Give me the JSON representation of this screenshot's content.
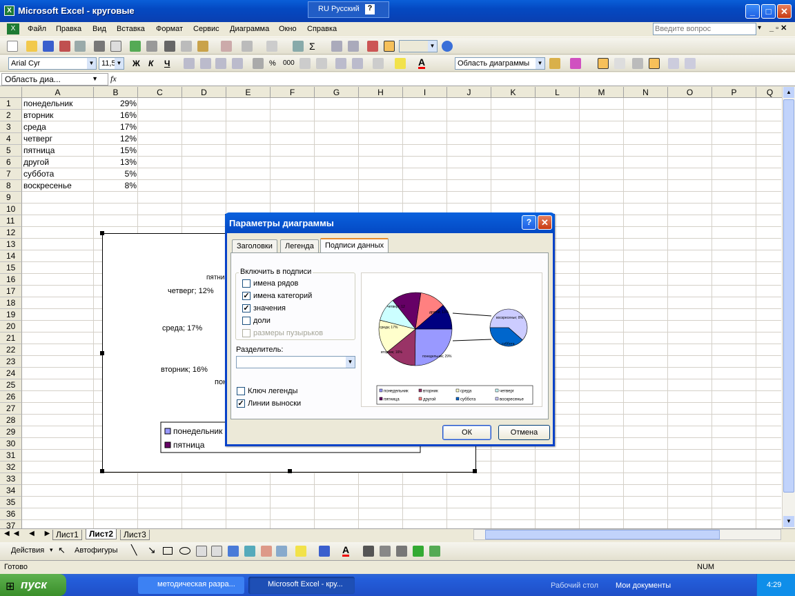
{
  "window": {
    "title": "Microsoft Excel - круговые"
  },
  "langbar": {
    "label": "RU Русский"
  },
  "menu": {
    "items": [
      "Файл",
      "Правка",
      "Вид",
      "Вставка",
      "Формат",
      "Сервис",
      "Диаграмма",
      "Окно",
      "Справка"
    ],
    "ask_placeholder": "Введите вопрос"
  },
  "formatting": {
    "font": "Arial Cyr",
    "size": "11,5",
    "bold": "Ж",
    "italic": "К",
    "underline": "Ч",
    "chart_object": "Область диаграммы"
  },
  "formula_bar": {
    "name_box": "Область диа...",
    "fx": "fx"
  },
  "columns": [
    "A",
    "B",
    "C",
    "D",
    "E",
    "F",
    "G",
    "H",
    "I",
    "J",
    "K",
    "L",
    "M",
    "N",
    "O",
    "P",
    "Q"
  ],
  "rows": [
    "1",
    "2",
    "3",
    "4",
    "5",
    "6",
    "7",
    "8",
    "9",
    "10",
    "11",
    "12",
    "13",
    "14",
    "15",
    "16",
    "17",
    "18",
    "19",
    "20",
    "21",
    "22",
    "23",
    "24",
    "25",
    "26",
    "27",
    "28",
    "29",
    "30",
    "31",
    "32",
    "33",
    "34",
    "35",
    "36",
    "37"
  ],
  "sheet_data": [
    {
      "day": "понедельник",
      "pct": "29%"
    },
    {
      "day": "вторник",
      "pct": "16%"
    },
    {
      "day": "среда",
      "pct": "17%"
    },
    {
      "day": "четверг",
      "pct": "12%"
    },
    {
      "day": "пятница",
      "pct": "15%"
    },
    {
      "day": "другой",
      "pct": "13%"
    },
    {
      "day": "суббота",
      "pct": "5%"
    },
    {
      "day": "воскресенье",
      "pct": "8%"
    }
  ],
  "chart_behind": {
    "labels": [
      "четверг; 12%",
      "среда; 17%",
      "вторник; 16%",
      "пятни",
      "поне"
    ],
    "legend": [
      "понедельник",
      "пятница"
    ]
  },
  "sheet_tabs": [
    "Лист1",
    "Лист2",
    "Лист3"
  ],
  "drawing": {
    "actions": "Действия",
    "autoshapes": "Автофигуры"
  },
  "status": {
    "ready": "Готово",
    "num": "NUM"
  },
  "taskbar": {
    "start": "пуск",
    "tasks": [
      "методическая разра...",
      "Microsoft Excel - кру..."
    ],
    "desktop": "Рабочий стол",
    "docs": "Мои документы",
    "time": "4:29"
  },
  "dialog": {
    "title": "Параметры диаграммы",
    "tabs": [
      "Заголовки",
      "Легенда",
      "Подписи данных"
    ],
    "group_title": "Включить в подписи",
    "options": [
      {
        "label": "имена рядов",
        "checked": false,
        "enabled": true
      },
      {
        "label": "имена категорий",
        "checked": true,
        "enabled": true
      },
      {
        "label": "значения",
        "checked": true,
        "enabled": true
      },
      {
        "label": "доли",
        "checked": false,
        "enabled": true
      },
      {
        "label": "размеры пузырьков",
        "checked": false,
        "enabled": false
      }
    ],
    "separator_label": "Разделитель:",
    "legend_key": {
      "label": "Ключ легенды",
      "checked": false
    },
    "leader_lines": {
      "label": "Линии выноски",
      "checked": true
    },
    "ok": "ОК",
    "cancel": "Отмена"
  },
  "chart_data": {
    "type": "pie",
    "categories": [
      "понедельник",
      "вторник",
      "среда",
      "четверг",
      "пятница",
      "другой",
      "суббота",
      "воскресенье"
    ],
    "values": [
      29,
      16,
      17,
      12,
      15,
      13,
      5,
      8
    ],
    "preview_labels": [
      "четверг; 12",
      "среда; 17%",
      "вторник; 16%",
      "понедельник; 29%",
      "другой; 13%",
      "воскресенье; 8%",
      "суббота"
    ],
    "colors": {
      "понедельник": "#9999ff",
      "вторник": "#993366",
      "среда": "#ffffcc",
      "четверг": "#ccffff",
      "пятница": "#660066",
      "другой": "#ff8080",
      "суббота": "#0066cc",
      "воскресенье": "#ccccff"
    }
  }
}
